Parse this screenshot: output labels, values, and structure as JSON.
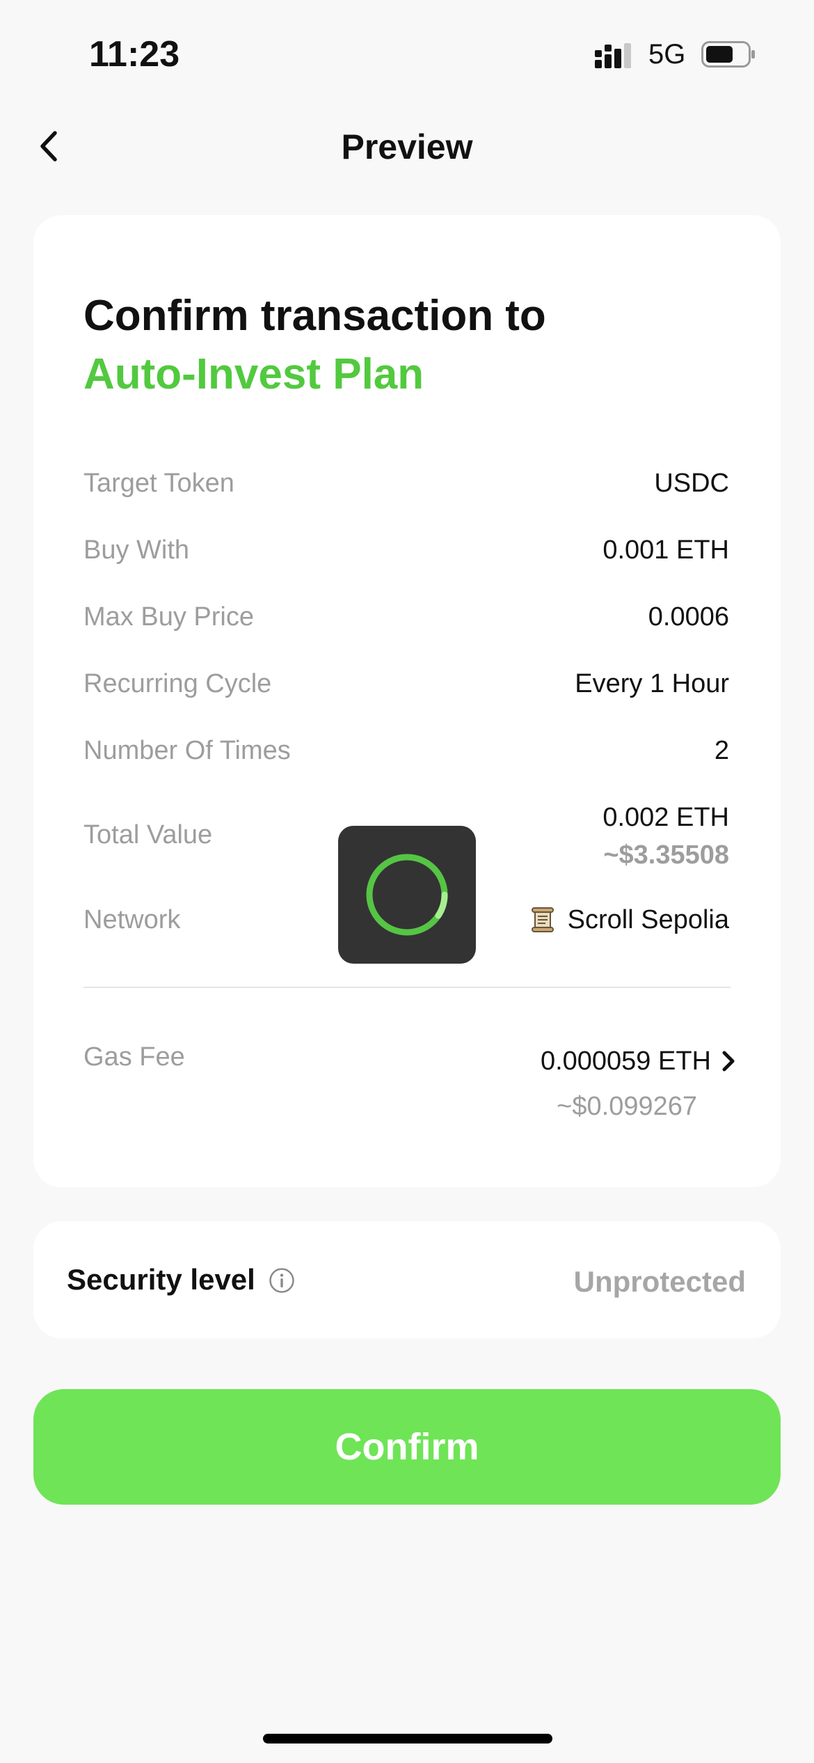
{
  "status_bar": {
    "time": "11:23",
    "network": "5G",
    "battery_level": 0.65
  },
  "nav": {
    "title": "Preview",
    "back_icon": "chevron-left-icon"
  },
  "card": {
    "heading": "Confirm transaction to",
    "heading_accent": "Auto-Invest Plan",
    "accent_color": "#52c93f",
    "rows": [
      {
        "label": "Target Token",
        "value": "USDC"
      },
      {
        "label": "Buy With",
        "value": "0.001 ETH"
      },
      {
        "label": "Max Buy Price",
        "value": "0.0006"
      },
      {
        "label": "Recurring Cycle",
        "value": "Every 1 Hour"
      },
      {
        "label": "Number Of Times",
        "value": "2"
      },
      {
        "label": "Total Value",
        "value": "0.002 ETH",
        "subvalue": "~$3.35508"
      },
      {
        "label": "Network",
        "value": "Scroll Sepolia",
        "icon": "scroll-icon"
      }
    ],
    "gas": {
      "label": "Gas Fee",
      "value": "0.000059 ETH",
      "subvalue": "~$0.099267",
      "icon": "chevron-right-icon"
    }
  },
  "loader": {
    "icon": "loading-spinner-icon",
    "color": "#6fe457"
  },
  "security": {
    "label": "Security level",
    "icon": "info-icon",
    "value": "Unprotected"
  },
  "confirm": {
    "label": "Confirm",
    "color": "#6fe457"
  }
}
